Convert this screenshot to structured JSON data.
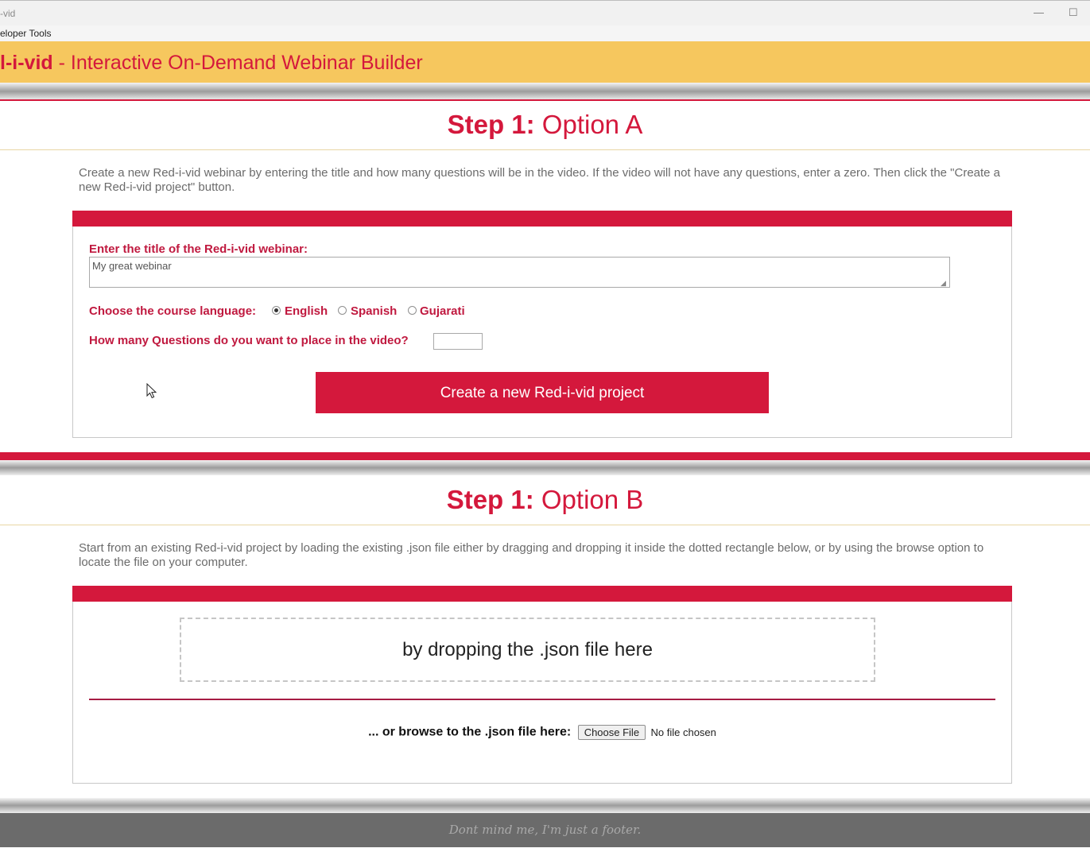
{
  "window": {
    "title": "-vid",
    "minimize_glyph": "—",
    "maximize_glyph": "☐"
  },
  "menubar": {
    "devtools_label": "eloper Tools"
  },
  "header": {
    "brand": "l-i-vid",
    "subtitle": " - Interactive On-Demand Webinar Builder"
  },
  "optionA": {
    "step_label": "Step 1:",
    "option_label": " Option A",
    "description": "Create a new Red-i-vid webinar by entering the title and how many questions will be in the video. If the video will not have any questions, enter a zero. Then click the \"Create a new Red-i-vid project\" button.",
    "title_label": "Enter the title of the Red-i-vid webinar:",
    "title_value": "My great webinar",
    "language_label": "Choose the course language:",
    "languages": [
      {
        "label": "English",
        "selected": true
      },
      {
        "label": "Spanish",
        "selected": false
      },
      {
        "label": "Gujarati",
        "selected": false
      }
    ],
    "questions_label": "How many Questions do you want to place in the video?",
    "questions_value": "",
    "create_button_label": "Create a new Red-i-vid project"
  },
  "optionB": {
    "step_label": "Step 1:",
    "option_label": " Option B",
    "description": "Start from an existing Red-i-vid project by loading the existing .json file either by dragging and dropping it inside the dotted rectangle below, or by using the browse option to locate the file on your computer.",
    "drop_text": "by dropping the .json file here",
    "browse_label": "... or browse to the .json file here:",
    "choose_file_label": "Choose File",
    "no_file_text": "No file chosen"
  },
  "footer": {
    "text": "Dont mind me, I'm just a footer."
  },
  "colors": {
    "accent_red": "#d4183c",
    "header_yellow": "#f6c75e",
    "footer_gray": "#6b6b6b"
  }
}
